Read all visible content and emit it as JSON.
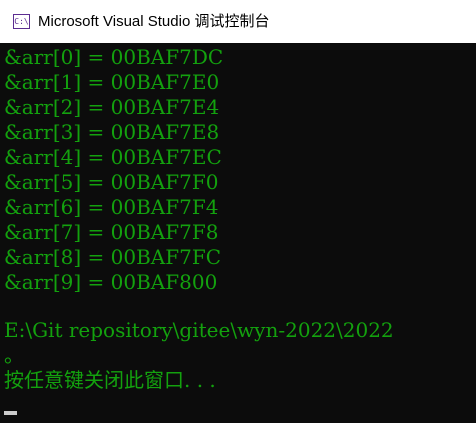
{
  "window": {
    "title": "Microsoft Visual Studio 调试控制台",
    "icon": "visual-studio-console-icon",
    "icon_glyph": "C:\\"
  },
  "console": {
    "text_color": "#13a10e",
    "background": "#0c0c0c",
    "lines": [
      "&arr[0] = 00BAF7DC",
      "&arr[1] = 00BAF7E0",
      "&arr[2] = 00BAF7E4",
      "&arr[3] = 00BAF7E8",
      "&arr[4] = 00BAF7EC",
      "&arr[5] = 00BAF7F0",
      "&arr[6] = 00BAF7F4",
      "&arr[7] = 00BAF7F8",
      "&arr[8] = 00BAF7FC",
      "&arr[9] = 00BAF800",
      "",
      "E:\\Git repository\\gitee\\wyn-2022\\2022",
      "。",
      "按任意键关闭此窗口. . ."
    ]
  }
}
